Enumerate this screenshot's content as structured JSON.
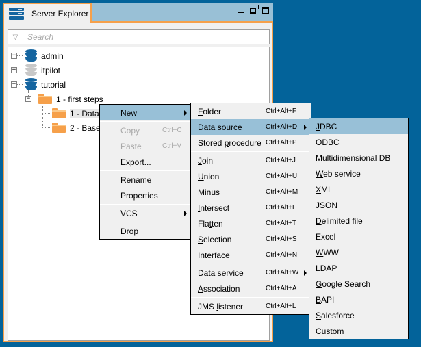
{
  "panel": {
    "title": "Server Explorer",
    "icon": "server-stack-icon",
    "controls": [
      "minimize-icon",
      "restore-icon",
      "maximize-icon"
    ],
    "search": {
      "placeholder": "Search",
      "value": "",
      "filter_icon": "filter-triangle-icon"
    }
  },
  "tree": [
    {
      "label": "admin",
      "icon": "database-icon",
      "state": "collapsed",
      "color": "#1565a0"
    },
    {
      "label": "itpilot",
      "icon": "database-icon",
      "state": "collapsed",
      "color": "#c8c8c8"
    },
    {
      "label": "tutorial",
      "icon": "database-icon",
      "state": "expanded",
      "color": "#1565a0"
    },
    {
      "label": "1 - first steps",
      "icon": "folder-icon",
      "state": "expanded"
    },
    {
      "label": "1 - Data S",
      "icon": "folder-icon",
      "selected": true
    },
    {
      "label": "2 - Base V",
      "icon": "folder-icon"
    }
  ],
  "context_menu": {
    "items": [
      {
        "label": "New",
        "submenu": true,
        "hover": true
      },
      {
        "label": "Copy",
        "shortcut": "Ctrl+C",
        "disabled": true
      },
      {
        "label": "Paste",
        "shortcut": "Ctrl+V",
        "disabled": true
      },
      {
        "label": "Export..."
      },
      {
        "label": "Rename"
      },
      {
        "label": "Properties"
      },
      {
        "label": "VCS",
        "submenu": true
      },
      {
        "label": "Drop"
      }
    ]
  },
  "new_menu": {
    "items": [
      {
        "pre": "",
        "u": "F",
        "post": "older",
        "shortcut": "Ctrl+Alt+F"
      },
      {
        "pre": "",
        "u": "D",
        "post": "ata source",
        "shortcut": "Ctrl+Alt+D",
        "submenu": true,
        "hover": true
      },
      {
        "pre": "Stored ",
        "u": "p",
        "post": "rocedure",
        "shortcut": "Ctrl+Alt+P"
      },
      {
        "pre": "",
        "u": "J",
        "post": "oin",
        "shortcut": "Ctrl+Alt+J"
      },
      {
        "pre": "",
        "u": "U",
        "post": "nion",
        "shortcut": "Ctrl+Alt+U"
      },
      {
        "pre": "",
        "u": "M",
        "post": "inus",
        "shortcut": "Ctrl+Alt+M"
      },
      {
        "pre": "",
        "u": "I",
        "post": "ntersect",
        "shortcut": "Ctrl+Alt+I"
      },
      {
        "pre": "Fla",
        "u": "t",
        "post": "ten",
        "shortcut": "Ctrl+Alt+T"
      },
      {
        "pre": "",
        "u": "S",
        "post": "election",
        "shortcut": "Ctrl+Alt+S"
      },
      {
        "pre": "I",
        "u": "n",
        "post": "terface",
        "shortcut": "Ctrl+Alt+N"
      },
      {
        "pre": "Data service",
        "u": "",
        "post": "",
        "shortcut": "Ctrl+Alt+W",
        "submenu": true
      },
      {
        "pre": "",
        "u": "A",
        "post": "ssociation",
        "shortcut": "Ctrl+Alt+A"
      },
      {
        "pre": "JMS ",
        "u": "l",
        "post": "istener",
        "shortcut": "Ctrl+Alt+L"
      }
    ]
  },
  "datasource_menu": {
    "items": [
      {
        "pre": "",
        "u": "J",
        "post": "DBC",
        "hover": true
      },
      {
        "pre": "",
        "u": "O",
        "post": "DBC"
      },
      {
        "pre": "",
        "u": "M",
        "post": "ultidimensional DB"
      },
      {
        "pre": "",
        "u": "W",
        "post": "eb service"
      },
      {
        "pre": "",
        "u": "X",
        "post": "ML"
      },
      {
        "pre": "JSO",
        "u": "N",
        "post": ""
      },
      {
        "pre": "",
        "u": "D",
        "post": "elimited file"
      },
      {
        "pre": "Excel",
        "u": "",
        "post": ""
      },
      {
        "pre": "",
        "u": "W",
        "post": "WW"
      },
      {
        "pre": "",
        "u": "L",
        "post": "DAP"
      },
      {
        "pre": "",
        "u": "G",
        "post": "oogle Search"
      },
      {
        "pre": "",
        "u": "B",
        "post": "API"
      },
      {
        "pre": "",
        "u": "S",
        "post": "alesforce"
      },
      {
        "pre": "",
        "u": "C",
        "post": "ustom"
      }
    ]
  }
}
